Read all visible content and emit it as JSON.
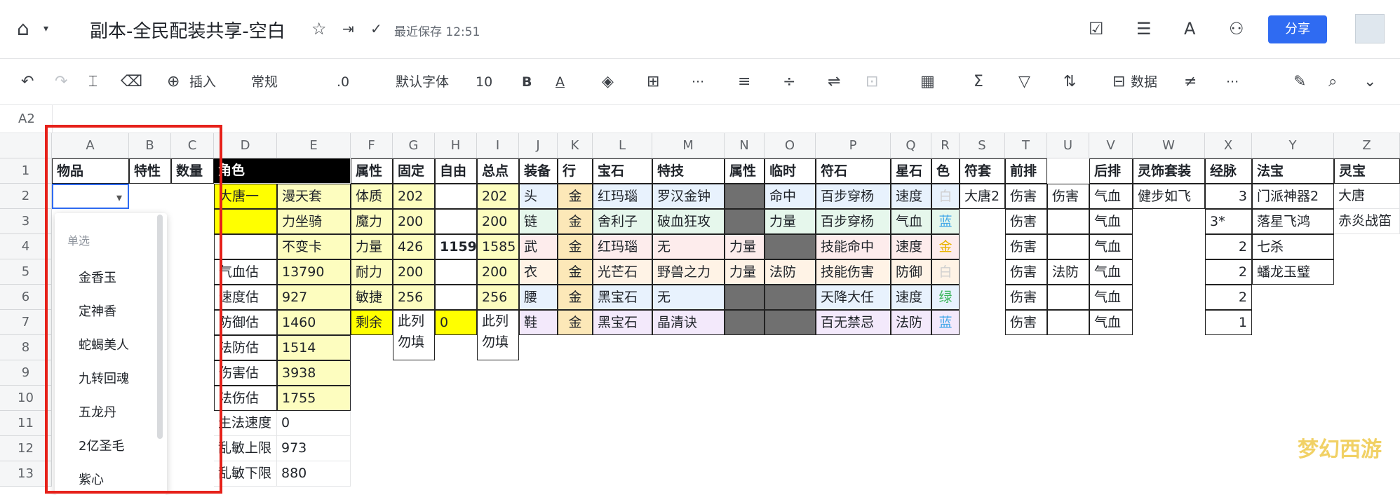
{
  "app": {
    "title": "副本-全民配装共享-空白",
    "save_status": "最近保存 12:51",
    "share_label": "分享"
  },
  "toolbar": {
    "insert": "插入",
    "format": "常规",
    "decimal": ".0",
    "font": "默认字体",
    "size": "10",
    "bold": "B",
    "font_color": "A",
    "data": "数据",
    "more": "···"
  },
  "name_box": "A2",
  "columns": [
    "A",
    "B",
    "C",
    "D",
    "E",
    "F",
    "G",
    "H",
    "I",
    "J",
    "K",
    "L",
    "M",
    "N",
    "O",
    "P",
    "Q",
    "R",
    "S",
    "T",
    "U",
    "V",
    "W",
    "X",
    "Y",
    "Z"
  ],
  "rows": [
    "1",
    "2",
    "3",
    "4",
    "5",
    "6",
    "7",
    "8",
    "9",
    "10",
    "11",
    "12",
    "13"
  ],
  "header_row": {
    "A": "物品",
    "B": "特性",
    "C": "数量",
    "D": "角色",
    "F": "属性",
    "G": "固定",
    "H": "自由",
    "I": "总点",
    "J": "装备",
    "K": "行",
    "L": "宝石",
    "M": "特技",
    "N": "属性",
    "O": "临时",
    "P": "符石",
    "Q": "星石",
    "R": "色",
    "S": "符套",
    "T": "前排",
    "V": "后排",
    "W": "灵饰套装",
    "X": "经脉",
    "Y": "法宝",
    "Z": "灵宝"
  },
  "role": {
    "D2": "大唐一",
    "E2": "漫天套",
    "E3": "力坐骑",
    "E4": "不变卡",
    "D5": "气血估",
    "E5": "13790",
    "D6": "速度估",
    "E6": "927",
    "D7": "防御估",
    "E7": "1460",
    "D8": "法防估",
    "E8": "1514",
    "D9": "伤害估",
    "E9": "3938",
    "D10": "法伤估",
    "E10": "1755",
    "D11": "生法速度",
    "E11": "0",
    "D12": "乱敏上限",
    "E12": "973",
    "D13": "乱敏下限",
    "E13": "880"
  },
  "attrs": {
    "F": [
      "体质",
      "魔力",
      "力量",
      "耐力",
      "敏捷",
      "剩余"
    ],
    "G": [
      "202",
      "200",
      "426",
      "200",
      "256",
      "此列勿填"
    ],
    "H": [
      "",
      "",
      "1159",
      "",
      "",
      "0"
    ],
    "I": [
      "202",
      "200",
      "1585",
      "200",
      "256",
      "此列勿填"
    ]
  },
  "equip": {
    "J": [
      "头",
      "链",
      "武",
      "衣",
      "腰",
      "鞋"
    ],
    "K": [
      "金",
      "金",
      "金",
      "金",
      "金",
      "金"
    ],
    "L": [
      "红玛瑙",
      "舍利子",
      "红玛瑙",
      "光芒石",
      "黑宝石",
      "黑宝石"
    ],
    "M": [
      "罗汉金钟",
      "破血狂攻",
      "无",
      "野兽之力",
      "无",
      "晶清诀"
    ],
    "N": [
      "",
      "",
      "力量",
      "力量",
      "",
      ""
    ],
    "O": [
      "命中",
      "力量",
      "",
      "法防",
      "",
      ""
    ],
    "P": [
      "百步穿杨",
      "百步穿杨",
      "技能命中",
      "技能伤害",
      "天降大任",
      "百无禁忌"
    ],
    "Q": [
      "速度",
      "气血",
      "速度",
      "防御",
      "速度",
      "法防"
    ],
    "R": [
      "白",
      "蓝",
      "金",
      "白",
      "绿",
      "蓝"
    ]
  },
  "extra": {
    "S2": "大唐2",
    "T": [
      "伤害",
      "伤害",
      "伤害",
      "伤害",
      "伤害",
      "伤害"
    ],
    "U2": "伤害",
    "U5": "法防",
    "V": [
      "气血",
      "气血",
      "气血",
      "气血",
      "气血",
      "气血"
    ],
    "W2": "健步如飞",
    "X": [
      "3",
      "3*",
      "2",
      "2",
      "2",
      "1"
    ],
    "Y": [
      "门派神器2",
      "落星飞鸿",
      "七杀",
      "蟠龙玉璧"
    ],
    "Z": [
      "大唐",
      "赤炎战笛"
    ]
  },
  "dropdown": {
    "header": "单选",
    "options": [
      "金香玉",
      "定神香",
      "蛇蝎美人",
      "九转回魂",
      "五龙丹",
      "2亿圣毛",
      "紫心"
    ]
  },
  "watermark": "梦幻西游"
}
